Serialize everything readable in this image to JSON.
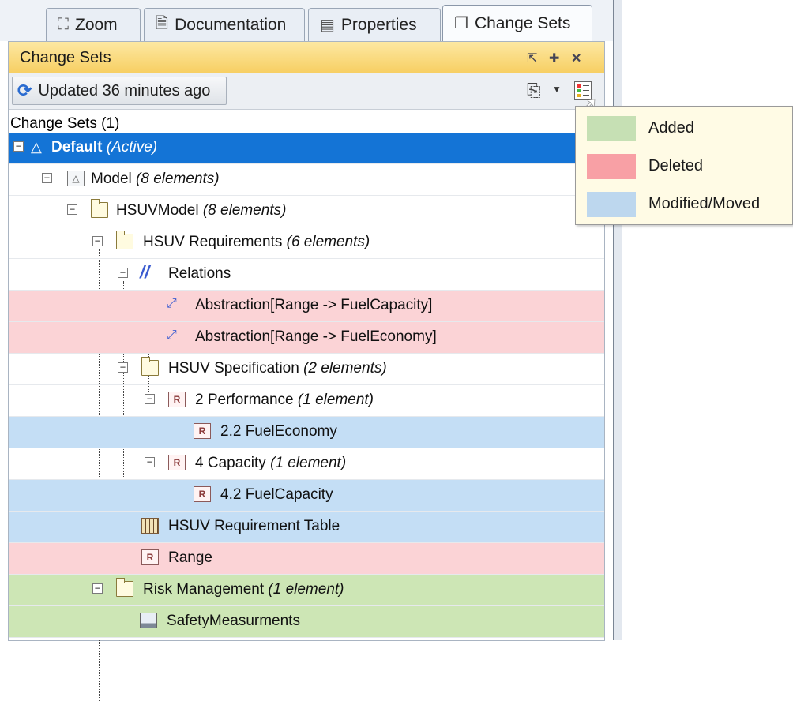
{
  "tabs": [
    {
      "label": "Zoom",
      "icon": "zoom-icon"
    },
    {
      "label": "Documentation",
      "icon": "document-icon"
    },
    {
      "label": "Properties",
      "icon": "properties-icon"
    },
    {
      "label": "Change Sets",
      "icon": "change-sets-icon"
    }
  ],
  "panel": {
    "title": "Change Sets"
  },
  "toolbar": {
    "update_label": "Updated 36 minutes ago"
  },
  "tree": {
    "header": "Change Sets (1)",
    "rows": [
      {
        "name": "Default",
        "note": "(Active)"
      },
      {
        "name": "Model",
        "note": "(8 elements)"
      },
      {
        "name": "HSUVModel",
        "note": "(8 elements)"
      },
      {
        "name": "HSUV Requirements",
        "note": "(6 elements)"
      },
      {
        "name": "Relations",
        "note": ""
      },
      {
        "name": "Abstraction[Range -> FuelCapacity]",
        "note": ""
      },
      {
        "name": "Abstraction[Range -> FuelEconomy]",
        "note": ""
      },
      {
        "name": "HSUV Specification",
        "note": "(2 elements)"
      },
      {
        "name": "2 Performance",
        "note": "(1 element)"
      },
      {
        "name": "2.2 FuelEconomy",
        "note": ""
      },
      {
        "name": "4 Capacity",
        "note": "(1 element)"
      },
      {
        "name": "4.2 FuelCapacity",
        "note": ""
      },
      {
        "name": "HSUV Requirement Table",
        "note": ""
      },
      {
        "name": "Range",
        "note": ""
      },
      {
        "name": "Risk Management",
        "note": "(1 element)"
      },
      {
        "name": "SafetyMeasurments",
        "note": ""
      }
    ]
  },
  "legend": {
    "items": [
      {
        "label": "Added",
        "color": "#c6e0b4"
      },
      {
        "label": "Deleted",
        "color": "#f8a0a5"
      },
      {
        "label": "Modified/Moved",
        "color": "#bdd7ee"
      }
    ]
  },
  "colors": {
    "added": "#cde6b5",
    "deleted": "#fbd3d6",
    "modified": "#c4def5",
    "selected": "#1474d6",
    "title_bar": "#f7cf63"
  }
}
